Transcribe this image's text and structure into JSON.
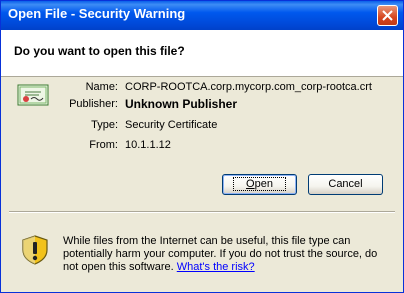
{
  "window": {
    "title": "Open File - Security Warning"
  },
  "header": {
    "question": "Do you want to open this file?"
  },
  "file": {
    "name_label": "Name:",
    "name_value": "CORP-ROOTCA.corp.mycorp.com_corp-rootca.crt",
    "publisher_label": "Publisher:",
    "publisher_value": "Unknown Publisher",
    "type_label": "Type:",
    "type_value": "Security Certificate",
    "from_label": "From:",
    "from_value": "10.1.1.12"
  },
  "buttons": {
    "open_access": "O",
    "open_rest": "pen",
    "cancel": "Cancel"
  },
  "warning": {
    "text": "While files from the Internet can be useful, this file type can potentially harm your computer. If you do not trust the source, do not open this software.",
    "link": "What's the risk?"
  },
  "icons": {
    "close": "close-icon",
    "certificate": "certificate-icon",
    "shield": "shield-warning-icon"
  }
}
